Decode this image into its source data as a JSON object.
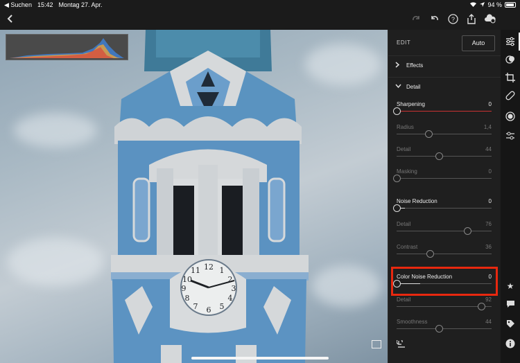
{
  "status_bar": {
    "back_app": "◀ Suchen",
    "time": "15:42",
    "date": "Montag 27. Apr.",
    "battery_percent": "94 %"
  },
  "toolbar": {
    "back_icon": "chevron-left-icon",
    "icons": [
      "redo-icon",
      "undo-icon",
      "help-icon",
      "share-icon",
      "cloud-sync-icon"
    ]
  },
  "photo": {
    "subject": "blue church tower with clock"
  },
  "panel": {
    "edit_label": "EDIT",
    "auto_label": "Auto",
    "sections": {
      "effects": "Effects",
      "detail": "Detail"
    },
    "sliders": {
      "sharpening": {
        "label": "Sharpening",
        "value": "0"
      },
      "radius": {
        "label": "Radius",
        "value": "1,4"
      },
      "detail1": {
        "label": "Detail",
        "value": "44"
      },
      "masking": {
        "label": "Masking",
        "value": "0"
      },
      "noise_reduction": {
        "label": "Noise Reduction",
        "value": "0"
      },
      "detail2": {
        "label": "Detail",
        "value": "76"
      },
      "contrast": {
        "label": "Contrast",
        "value": "36"
      },
      "color_noise_reduction": {
        "label": "Color Noise Reduction",
        "value": "0"
      },
      "detail3": {
        "label": "Detail",
        "value": "92"
      },
      "smoothness": {
        "label": "Smoothness",
        "value": "44"
      }
    }
  },
  "rail_icons": [
    "sliders-icon",
    "presets-icon",
    "crop-icon",
    "healing-icon",
    "selective-icon",
    "versions-icon",
    "rating-star-icon",
    "comment-icon",
    "tag-icon",
    "info-icon"
  ],
  "colors": {
    "highlight": "#e8280f",
    "panel_bg": "#1f1f1f"
  }
}
